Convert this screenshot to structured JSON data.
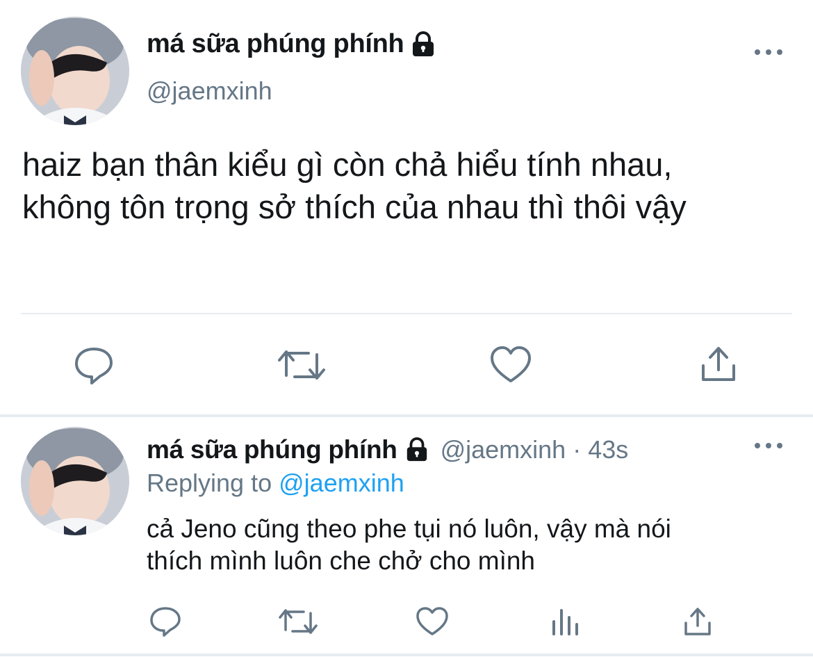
{
  "main_tweet": {
    "display_name": "má sữa phúng phính",
    "handle": "@jaemxinh",
    "text_lines": [
      "haiz bạn thân kiểu gì còn chả hiểu tính nhau,",
      "không tôn trọng sở thích của nhau thì thôi vậy"
    ],
    "icons": {
      "lock": "lock-icon",
      "more": "more-icon",
      "reply": "reply-icon",
      "retweet": "retweet-icon",
      "like": "like-icon",
      "share": "share-icon"
    }
  },
  "reply_tweet": {
    "display_name": "má sữa phúng phính",
    "handle": "@jaemxinh",
    "separator": "·",
    "time": "43s",
    "replying_prefix": "Replying to",
    "replying_handle": "@jaemxinh",
    "text_lines": [
      "cả Jeno cũng theo phe tụi nó luôn, vậy mà nói",
      "thích mình luôn che chở cho mình"
    ],
    "icons": {
      "lock": "lock-icon",
      "more": "more-icon",
      "reply": "reply-icon",
      "retweet": "retweet-icon",
      "like": "like-icon",
      "analytics": "analytics-icon",
      "share": "share-icon"
    }
  },
  "colors": {
    "text_primary": "#14171a",
    "text_secondary": "#657786",
    "link": "#1da1f2",
    "divider": "#e6ecf0"
  }
}
